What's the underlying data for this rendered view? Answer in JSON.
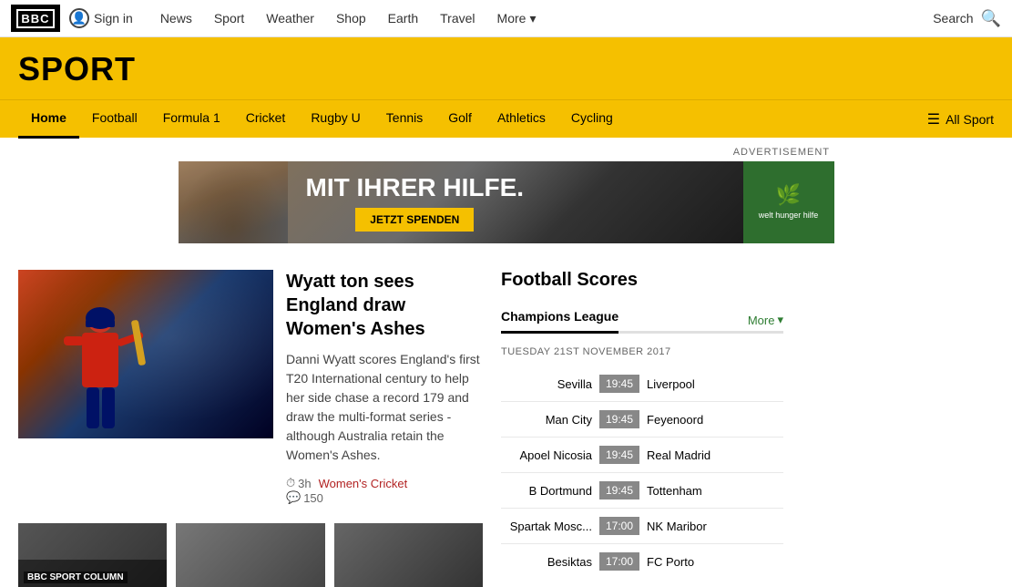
{
  "topnav": {
    "logo_text": "BBC",
    "signin_label": "Sign in",
    "links": [
      {
        "label": "News",
        "id": "news"
      },
      {
        "label": "Sport",
        "id": "sport"
      },
      {
        "label": "Weather",
        "id": "weather"
      },
      {
        "label": "Shop",
        "id": "shop"
      },
      {
        "label": "Earth",
        "id": "earth"
      },
      {
        "label": "Travel",
        "id": "travel"
      }
    ],
    "more_label": "More",
    "search_label": "Search"
  },
  "sport_banner": {
    "title": "SPORT"
  },
  "sport_nav": {
    "links": [
      {
        "label": "Home",
        "active": true,
        "id": "home"
      },
      {
        "label": "Football",
        "active": false,
        "id": "football"
      },
      {
        "label": "Formula 1",
        "active": false,
        "id": "formula1"
      },
      {
        "label": "Cricket",
        "active": false,
        "id": "cricket"
      },
      {
        "label": "Rugby U",
        "active": false,
        "id": "rugby"
      },
      {
        "label": "Tennis",
        "active": false,
        "id": "tennis"
      },
      {
        "label": "Golf",
        "active": false,
        "id": "golf"
      },
      {
        "label": "Athletics",
        "active": false,
        "id": "athletics"
      },
      {
        "label": "Cycling",
        "active": false,
        "id": "cycling"
      }
    ],
    "all_sport_label": "All Sport"
  },
  "advertisement": {
    "label": "ADVERTISEMENT",
    "main_text": "MIT IHRER HILFE.",
    "sub_text": "JETZT SPENDEN",
    "logo_name": "welt hunger hilfe"
  },
  "featured_article": {
    "title": "Wyatt ton sees England draw Women's Ashes",
    "description": "Danni Wyatt scores England's first T20 International century to help her side chase a record 179 and draw the multi-format series - although Australia retain the Women's Ashes.",
    "time": "3h",
    "tag": "Women's Cricket",
    "comment_count": "150"
  },
  "thumbnail_items": [
    {
      "label": "BBC SPORT COLUMN",
      "id": "thumb1"
    },
    {
      "label": "",
      "id": "thumb2"
    },
    {
      "label": "",
      "id": "thumb3"
    }
  ],
  "football_scores": {
    "title": "Football Scores",
    "tab_label": "Champions League",
    "more_label": "More",
    "date_label": "Tuesday 21st November 2017",
    "matches": [
      {
        "home": "Sevilla",
        "time": "19:45",
        "away": "Liverpool"
      },
      {
        "home": "Man City",
        "time": "19:45",
        "away": "Feyenoord"
      },
      {
        "home": "Apoel Nicosia",
        "time": "19:45",
        "away": "Real Madrid"
      },
      {
        "home": "B Dortmund",
        "time": "19:45",
        "away": "Tottenham"
      },
      {
        "home": "Spartak Mosc...",
        "time": "17:00",
        "away": "NK Maribor"
      },
      {
        "home": "Besiktas",
        "time": "17:00",
        "away": "FC Porto"
      }
    ]
  }
}
